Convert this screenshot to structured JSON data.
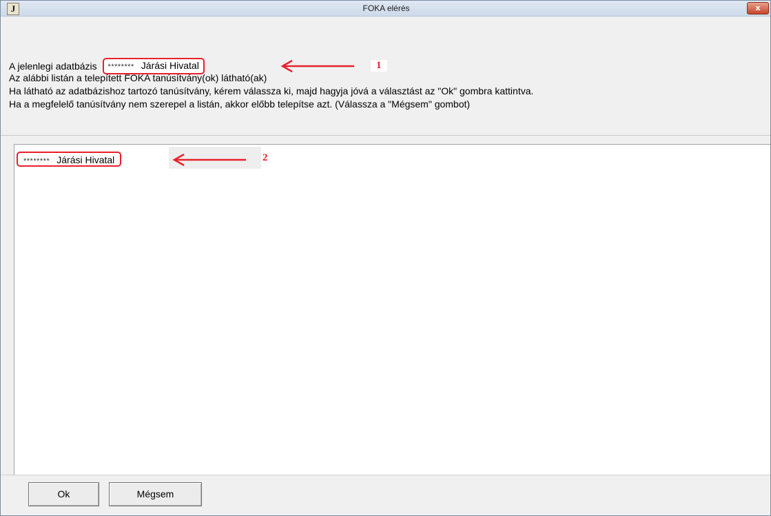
{
  "window": {
    "title": "FOKA elérés",
    "app_icon_letter": "J",
    "close_label": "x"
  },
  "info": {
    "line1_prefix": "A jelenlegi adatbázis",
    "current_db_mask": "********",
    "current_db_name": "Járási Hivatal",
    "line2": "Az alábbi listán a telepített FOKA tanúsítvány(ok) látható(ak)",
    "line3": "Ha látható az adatbázishoz tartozó tanúsítvány, kérem válassza ki, majd hagyja jóvá a választást az \"Ok\" gombra kattintva.",
    "line4": "Ha a megfelelő tanúsítvány nem szerepel a listán, akkor előbb telepítse azt. (Válassza a \"Mégsem\" gombot)"
  },
  "certificates": [
    {
      "mask": "********",
      "name": "Járási Hivatal"
    }
  ],
  "annotations": {
    "marker1": "1",
    "marker2": "2",
    "color": "#e8202a"
  },
  "buttons": {
    "ok_label": "Ok",
    "cancel_label": "Mégsem"
  }
}
